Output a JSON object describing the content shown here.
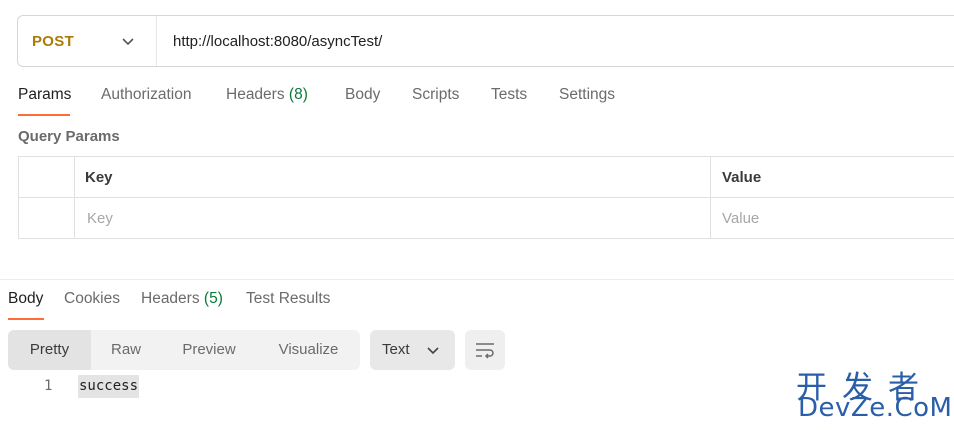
{
  "request": {
    "method": "POST",
    "url": "http://localhost:8080/asyncTest/"
  },
  "request_tabs": {
    "params": "Params",
    "authorization": "Authorization",
    "headers": "Headers",
    "headers_count": "(8)",
    "body": "Body",
    "scripts": "Scripts",
    "tests": "Tests",
    "settings": "Settings"
  },
  "query_params": {
    "title": "Query Params",
    "columns": [
      "Key",
      "Value"
    ],
    "placeholder_key": "Key",
    "placeholder_value": "Value"
  },
  "response_tabs": {
    "body": "Body",
    "cookies": "Cookies",
    "headers": "Headers",
    "headers_count": "(5)",
    "test_results": "Test Results"
  },
  "view_modes": [
    "Pretty",
    "Raw",
    "Preview",
    "Visualize"
  ],
  "format": "Text",
  "response_body": {
    "line_number": "1",
    "content": "success"
  },
  "watermark": {
    "chinese": "开发者",
    "latin": "DevZe.CoM"
  },
  "colors": {
    "method": "#ad7a03",
    "active_underline": "#ff6c37",
    "count": "#0a7a3a",
    "watermark": "#2a5ea8"
  },
  "icons": [
    "chevron-down-icon",
    "wrap-lines-icon"
  ]
}
